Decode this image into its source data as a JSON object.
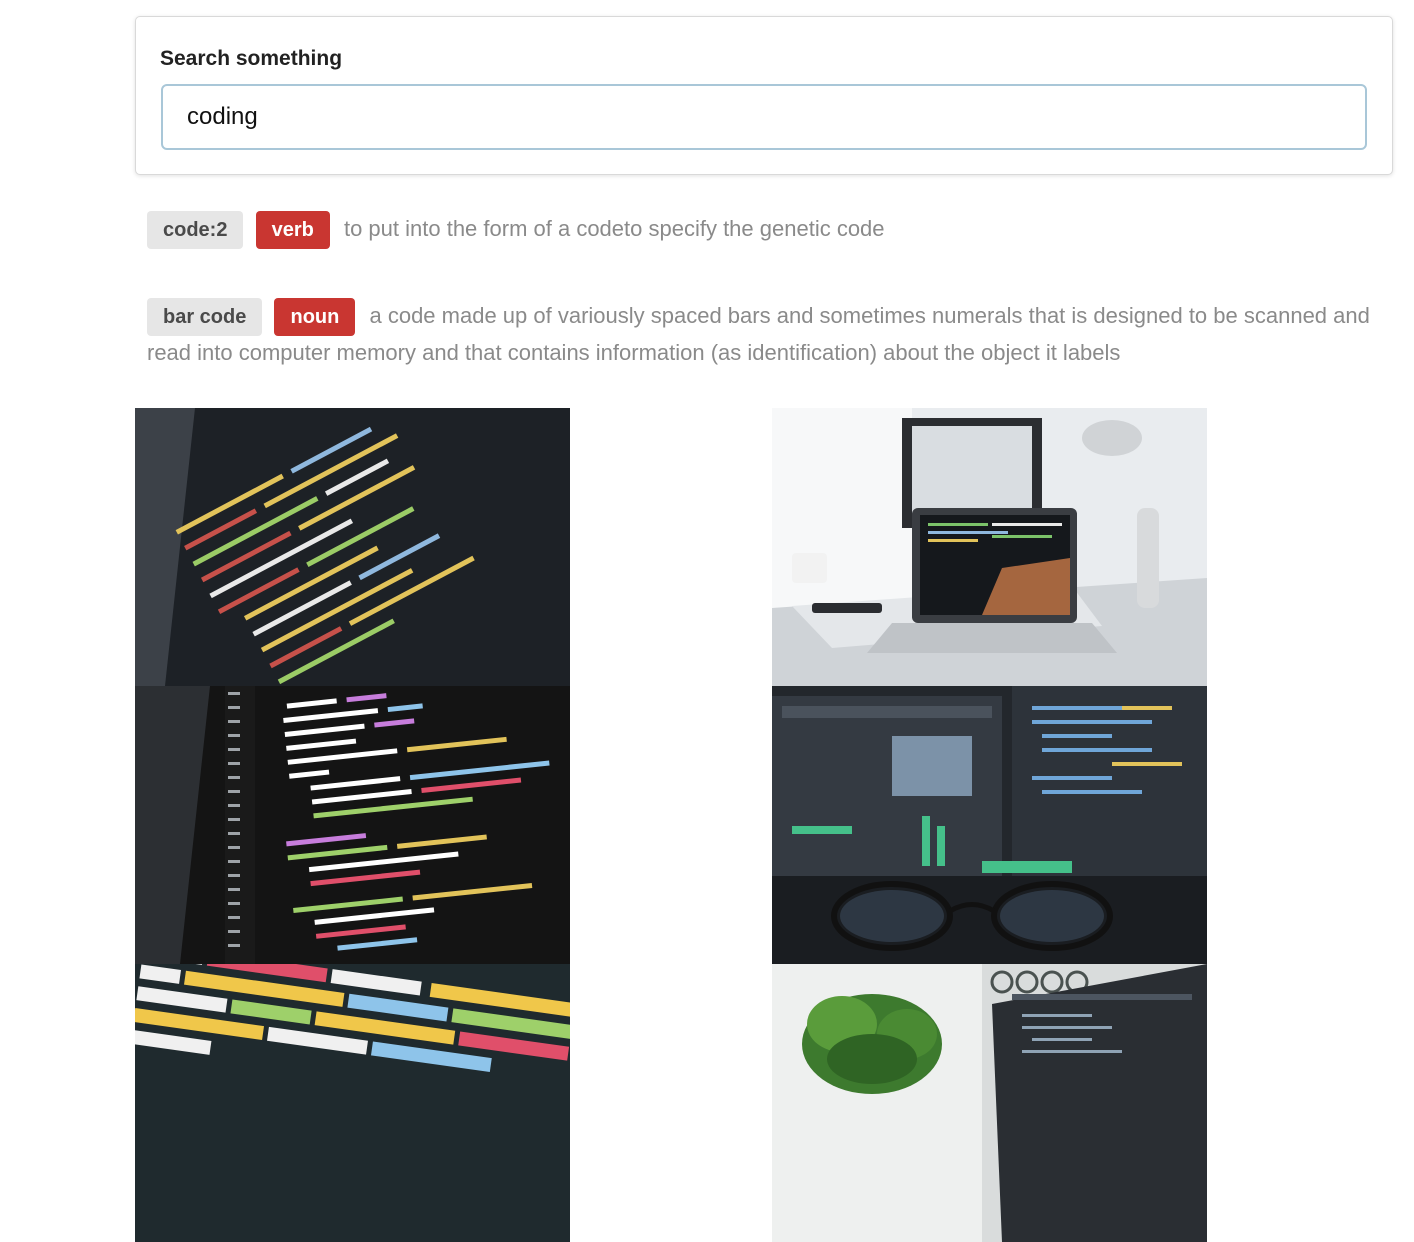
{
  "search": {
    "label": "Search something",
    "value": "coding",
    "placeholder": ""
  },
  "definitions": [
    {
      "word": "code:2",
      "pos": "verb",
      "text": "to put into the form of a codeto specify the genetic code"
    },
    {
      "word": "bar code",
      "pos": "noun",
      "text": "a code made up of variously spaced bars and sometimes numerals that is designed to be scanned and read into computer memory and that contains information (as identification) about the object it labels"
    }
  ],
  "images": [
    {
      "subject": "code-editor-closeup-php"
    },
    {
      "subject": "laptop-on-desk-with-lamp"
    },
    {
      "subject": "python-code-closeup"
    },
    {
      "subject": "monitors-through-glasses"
    },
    {
      "subject": "javascript-code-closeup"
    },
    {
      "subject": "plant-and-laptop"
    }
  ],
  "colors": {
    "pos_tag": "#c93631",
    "word_tag": "#e6e6e6",
    "input_border": "#a9c7d8"
  }
}
